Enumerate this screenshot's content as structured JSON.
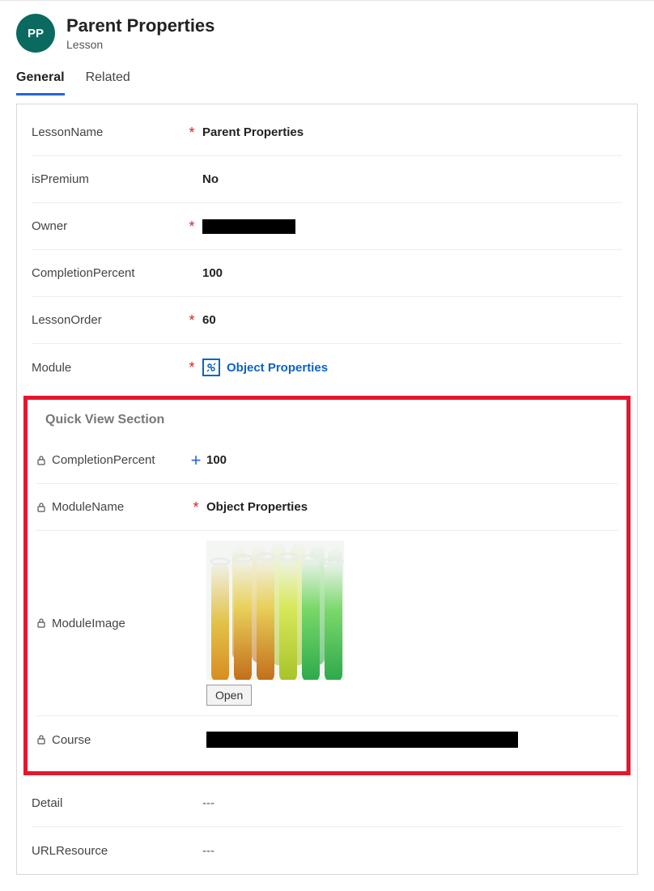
{
  "header": {
    "avatar": "PP",
    "title": "Parent Properties",
    "subtitle": "Lesson"
  },
  "tabs": {
    "general": "General",
    "related": "Related"
  },
  "fields": {
    "lessonName": {
      "label": "LessonName",
      "value": "Parent Properties"
    },
    "isPremium": {
      "label": "isPremium",
      "value": "No"
    },
    "owner": {
      "label": "Owner"
    },
    "completionPercent": {
      "label": "CompletionPercent",
      "value": "100"
    },
    "lessonOrder": {
      "label": "LessonOrder",
      "value": "60"
    },
    "module": {
      "label": "Module",
      "value": "Object Properties"
    }
  },
  "quickView": {
    "title": "Quick View Section",
    "completionPercent": {
      "label": "CompletionPercent",
      "value": "100"
    },
    "moduleName": {
      "label": "ModuleName",
      "value": "Object Properties"
    },
    "moduleImage": {
      "label": "ModuleImage",
      "openLabel": "Open"
    },
    "course": {
      "label": "Course"
    }
  },
  "lower": {
    "detail": {
      "label": "Detail",
      "value": "---"
    },
    "urlResource": {
      "label": "URLResource",
      "value": "---"
    }
  }
}
